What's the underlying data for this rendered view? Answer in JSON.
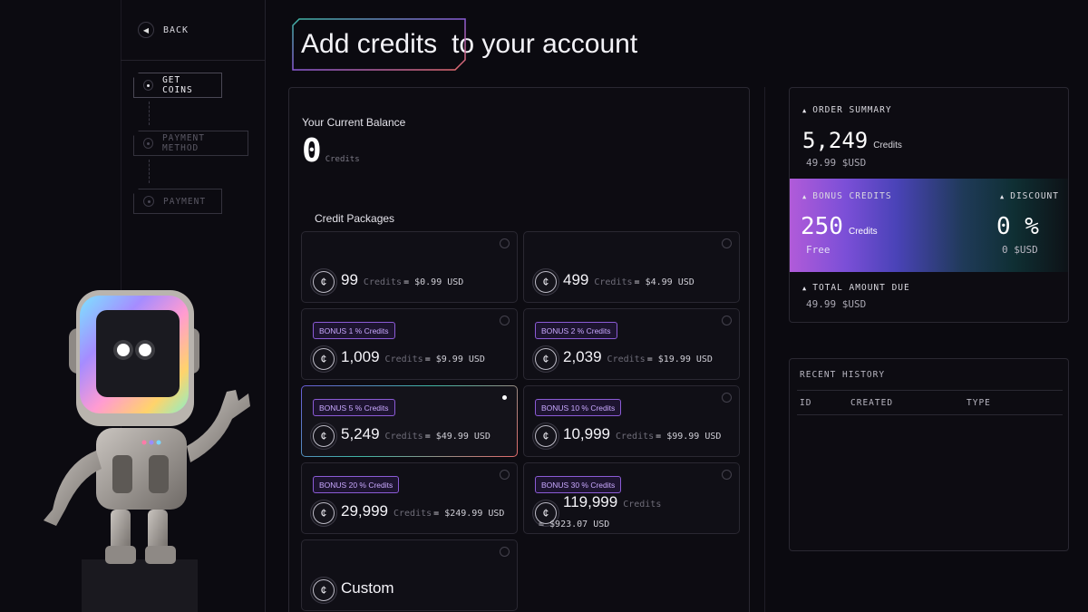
{
  "nav": {
    "back_label": "BACK",
    "steps": [
      {
        "label": "GET COINS",
        "state": "active"
      },
      {
        "label": "PAYMENT METHOD",
        "state": "inactive"
      },
      {
        "label": "PAYMENT",
        "state": "inactive"
      }
    ]
  },
  "header": {
    "title_highlight": "Add credits",
    "title_rest": "to your account"
  },
  "balance": {
    "label": "Your Current Balance",
    "value": "0",
    "unit": "Credits"
  },
  "packages": {
    "label": "Credit Packages",
    "coin_glyph": "¢",
    "items": [
      {
        "amount": "99",
        "credits_label": "Credits",
        "price": "= $0.99 USD",
        "bonus": "",
        "selected": false
      },
      {
        "amount": "499",
        "credits_label": "Credits",
        "price": "= $4.99 USD",
        "bonus": "",
        "selected": false
      },
      {
        "amount": "1,009",
        "credits_label": "Credits",
        "price": "= $9.99 USD",
        "bonus": "BONUS 1 % Credits",
        "selected": false
      },
      {
        "amount": "2,039",
        "credits_label": "Credits",
        "price": "= $19.99 USD",
        "bonus": "BONUS 2 % Credits",
        "selected": false
      },
      {
        "amount": "5,249",
        "credits_label": "Credits",
        "price": "= $49.99 USD",
        "bonus": "BONUS 5 % Credits",
        "selected": true
      },
      {
        "amount": "10,999",
        "credits_label": "Credits",
        "price": "= $99.99 USD",
        "bonus": "BONUS 10 % Credits",
        "selected": false
      },
      {
        "amount": "29,999",
        "credits_label": "Credits",
        "price": "= $249.99 USD",
        "bonus": "BONUS 20 % Credits",
        "selected": false
      },
      {
        "amount": "119,999",
        "credits_label": "Credits",
        "price": "= $923.07 USD",
        "bonus": "BONUS 30 % Credits",
        "selected": false
      },
      {
        "amount": "Custom",
        "credits_label": "",
        "price": "",
        "bonus": "",
        "selected": false
      }
    ]
  },
  "summary": {
    "order_label": "ORDER SUMMARY",
    "order_value": "5,249",
    "order_unit": "Credits",
    "order_usd": "49.99 $USD",
    "bonus_label": "BONUS CREDITS",
    "bonus_value": "250",
    "bonus_unit": "Credits",
    "bonus_free": "Free",
    "discount_label": "DISCOUNT",
    "discount_value": "0 %",
    "discount_usd": "0 $USD",
    "total_label": "TOTAL AMOUNT DUE",
    "total_value": "49.99 $USD"
  },
  "history": {
    "title": "RECENT HISTORY",
    "columns": [
      "ID",
      "CREATED",
      "TYPE"
    ]
  },
  "colors": {
    "background": "#0b0a10",
    "accent_purple": "#8b5bd6",
    "accent_teal": "#3fb6a4",
    "accent_red": "#e36a6a"
  }
}
